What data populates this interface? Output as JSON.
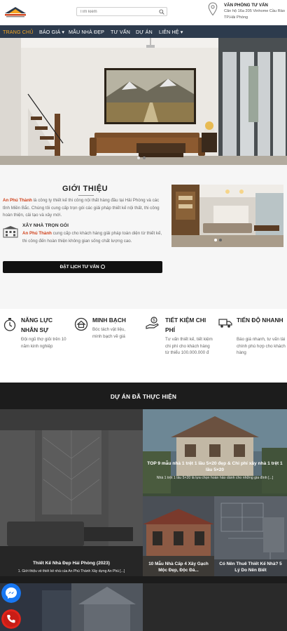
{
  "header": {
    "search_placeholder": "Tìm kiếm",
    "office_title": "VĂN PHÒNG TƯ VẤN",
    "office_address": "Căn hộ 16a 205 Vinhome Cầu Rào TP.Hải Phòng"
  },
  "nav": {
    "items": [
      {
        "label": "TRANG CHỦ",
        "active": true
      },
      {
        "label": "BÁO GIÁ ▾",
        "active": false
      },
      {
        "label": "MẪU NHÀ ĐẸP",
        "active": false
      },
      {
        "label": "TƯ VẤN",
        "active": false
      },
      {
        "label": "DỰ ÁN",
        "active": false
      },
      {
        "label": "LIÊN HỆ ▾",
        "active": false
      }
    ]
  },
  "hero": {
    "slide_count": 2,
    "active_slide": 0
  },
  "intro": {
    "title": "GIỚI THIỆU",
    "company": "An Phú Thành",
    "p1": " là công ty thiết kế thi công nội thất hàng đầu tại Hải Phòng và các tỉnh Miền Bắc. Chúng tôi cung cấp trọn gói các giải pháp thiết kế nội thất, thi công hoàn thiện, cải tạo và xây mới.",
    "sub_title": "XÂY NHÀ TRỌN GÓI",
    "p2_company": "An Phú Thành",
    "p2": " cung cấp cho khách hàng giải pháp toàn diện từ thiết kế, thi công đến hoàn thiện không gian sống chất lượng cao.",
    "cta_label": "ĐẶT LỊCH TƯ VẤN"
  },
  "features": [
    {
      "title": "NĂNG LỰC NHÂN SỰ",
      "desc": "Đội ngũ thợ giỏi trên 10 năm kinh nghiệp",
      "icon": "stopwatch-icon"
    },
    {
      "title": "MINH BẠCH",
      "desc": "Bóc tách vật liệu, minh bạch về giá",
      "icon": "shield-house-icon"
    },
    {
      "title": "TIẾT KIỆM CHI PHÍ",
      "desc": "Tư vấn thiết kế, tiết kiệm chi phí cho khách hàng từ thiểu 100.000.000 đ",
      "icon": "money-hand-icon"
    },
    {
      "title": "TIẾN ĐỘ NHANH",
      "desc": "Báo giá nhanh, tư vấn tài chính phù hợp cho khách hàng",
      "icon": "truck-icon"
    }
  ],
  "projects": {
    "title": "DỰ ÁN ĐÃ THỰC HIỆN",
    "tiles": [
      {
        "caption": "Thiết Kế Nhà Đẹp Hải Phòng (2023)",
        "excerpt": "1. Giới thiệu về thiết kế nhà của An Phú Thành Xây dựng An Phú [...]"
      },
      {
        "caption": "TOP 9 mẫu nhà 1 trệt 1 lầu 5×20 đẹp & Chi phí xây nhà 1 trệt 1 lầu 5×20",
        "excerpt": "Nhà 1 trệt 1 lầu 5×20 là lựa chọn hoàn hảo dành cho những gia đình [...]"
      },
      {
        "caption": "10 Mẫu Nhà Cấp 4 Xây Gạch Mộc Đẹp, Độc Đá...",
        "excerpt": ""
      },
      {
        "caption": "Có Nên Thuê Thiết Kế Nhà? 5 Lý Do Nên Biết",
        "excerpt": ""
      }
    ]
  },
  "colors": {
    "nav_bg": "#2d3b4d",
    "accent": "#f5a623",
    "brand_red": "#d0421b",
    "messenger": "#1877f2",
    "phone": "#e0241b"
  }
}
